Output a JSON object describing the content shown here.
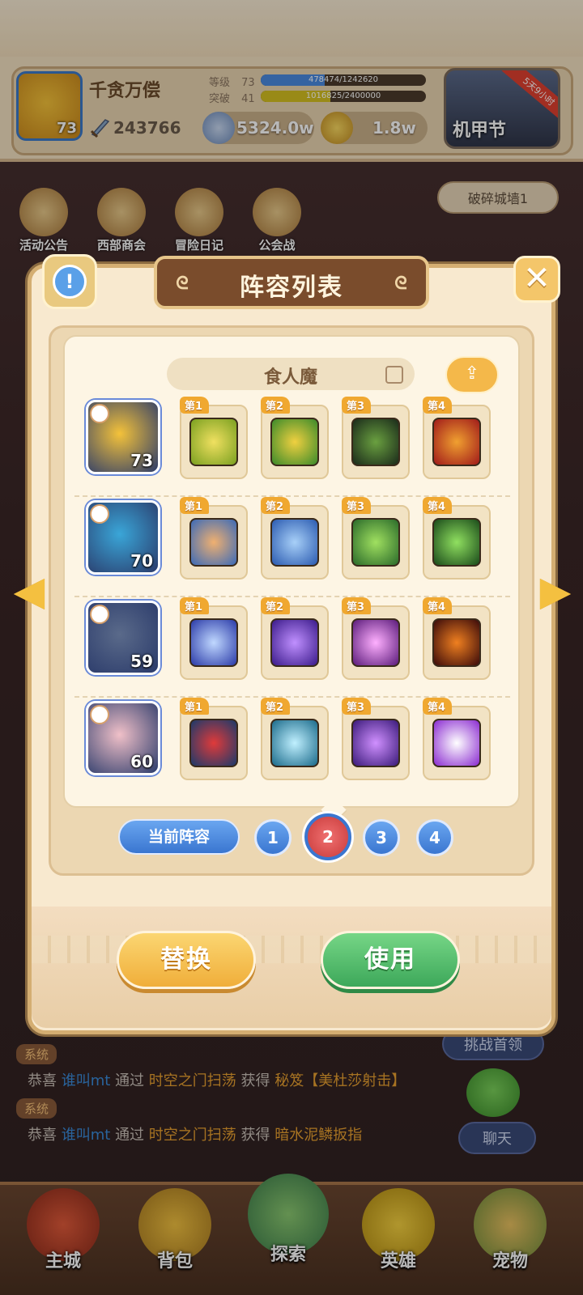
{
  "header": {
    "player_name": "千贪万偿",
    "avatar_level": "73",
    "power": "243766",
    "level_label": "等级",
    "level_value": "73",
    "level_progress": "478474/1242620",
    "level_fraction": 0.385,
    "breakthrough_label": "突破",
    "breakthrough_value": "41",
    "breakthrough_progress": "1016825/2400000",
    "breakthrough_fraction": 0.424,
    "silver": "5324.0w",
    "gold": "1.8w",
    "event_label": "机甲节",
    "event_ribbon": "5天9小时"
  },
  "menu": [
    {
      "label": "活动公告"
    },
    {
      "label": "西部商会"
    },
    {
      "label": "冒险日记"
    },
    {
      "label": "公会战"
    }
  ],
  "stage_button": "破碎城墙1",
  "dialog": {
    "title": "阵容列表",
    "team_name": "食人魔",
    "rows": [
      {
        "hero_level": "73",
        "hero_color": "#f4c23a",
        "slots": [
          "第1",
          "第2",
          "第3",
          "第4"
        ]
      },
      {
        "hero_level": "70",
        "hero_color": "#3aa6d8",
        "slots": [
          "第1",
          "第2",
          "第3",
          "第4"
        ]
      },
      {
        "hero_level": "59",
        "hero_color": "#5a6a8a",
        "slots": [
          "第1",
          "第2",
          "第3",
          "第4"
        ]
      },
      {
        "hero_level": "60",
        "hero_color": "#f0c0c8",
        "slots": [
          "第1",
          "第2",
          "第3",
          "第4"
        ]
      }
    ],
    "current_team_label": "当前阵容",
    "pages": [
      "1",
      "2",
      "3",
      "4"
    ],
    "active_page": "2",
    "replace_label": "替换",
    "use_label": "使用"
  },
  "chat": {
    "system_tag": "系统",
    "lines": [
      {
        "prefix": "恭喜",
        "name": "谁叫mt",
        "via": "通过",
        "place": "时空之门扫荡",
        "gain": "获得",
        "item": "秘笈【美杜莎射击】"
      },
      {
        "prefix": "恭喜",
        "name": "谁叫mt",
        "via": "通过",
        "place": "时空之门扫荡",
        "gain": "获得",
        "item": "暗水泥鳞扳指"
      }
    ],
    "challenge_label": "挑战首领",
    "chat_label": "聊天"
  },
  "nav": [
    {
      "label": "主城"
    },
    {
      "label": "背包"
    },
    {
      "label": "探索"
    },
    {
      "label": "英雄"
    },
    {
      "label": "宠物"
    }
  ],
  "colors": {
    "accent_gold": "#f4b84a",
    "accent_green": "#3da85a",
    "accent_blue": "#3a76d0",
    "active_page": "#c83a3a"
  }
}
